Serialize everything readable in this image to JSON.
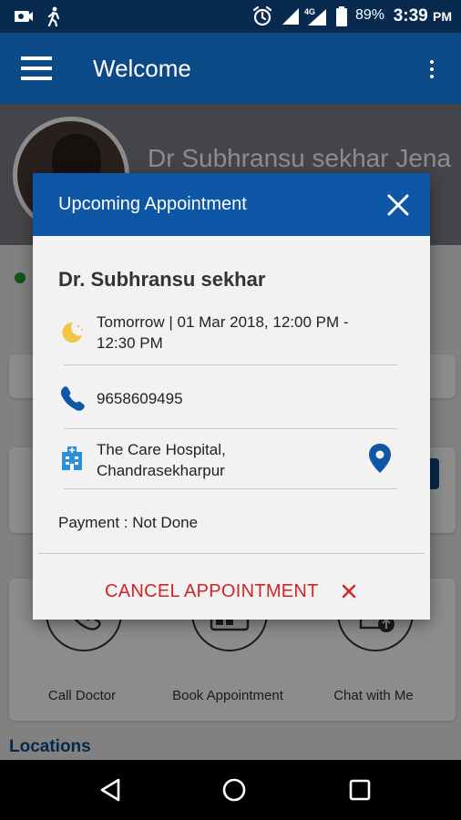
{
  "status_bar": {
    "battery_percent": "89%",
    "time": "3:39",
    "time_suffix": "PM",
    "network_label": "4G"
  },
  "app_bar": {
    "title": "Welcome"
  },
  "profile": {
    "doctor_name": "Dr Subhransu sekhar Jena"
  },
  "quick_actions": [
    {
      "label": "Call Doctor",
      "icon": "phone-plus-icon"
    },
    {
      "label": "Book Appointment",
      "icon": "calendar-grid-icon"
    },
    {
      "label": "Chat with Me",
      "icon": "document-upload-icon"
    }
  ],
  "locations_label": "Locations",
  "dialog": {
    "title": "Upcoming Appointment",
    "doctor_name": "Dr. Subhransu sekhar",
    "schedule_line1": "Tomorrow | 01 Mar 2018, 12:00 PM -",
    "schedule_line2": "12:30 PM",
    "phone": "9658609495",
    "hospital_line1": "The Care Hospital,",
    "hospital_line2": "Chandrasekharpur",
    "payment": "Payment : Not Done",
    "cancel_label": "CANCEL APPOINTMENT"
  },
  "colors": {
    "primary": "#0b4a87",
    "dialog_header": "#0d57a6",
    "cancel": "#d2232a",
    "online": "#1a9b32",
    "moon": "#f4c542"
  }
}
